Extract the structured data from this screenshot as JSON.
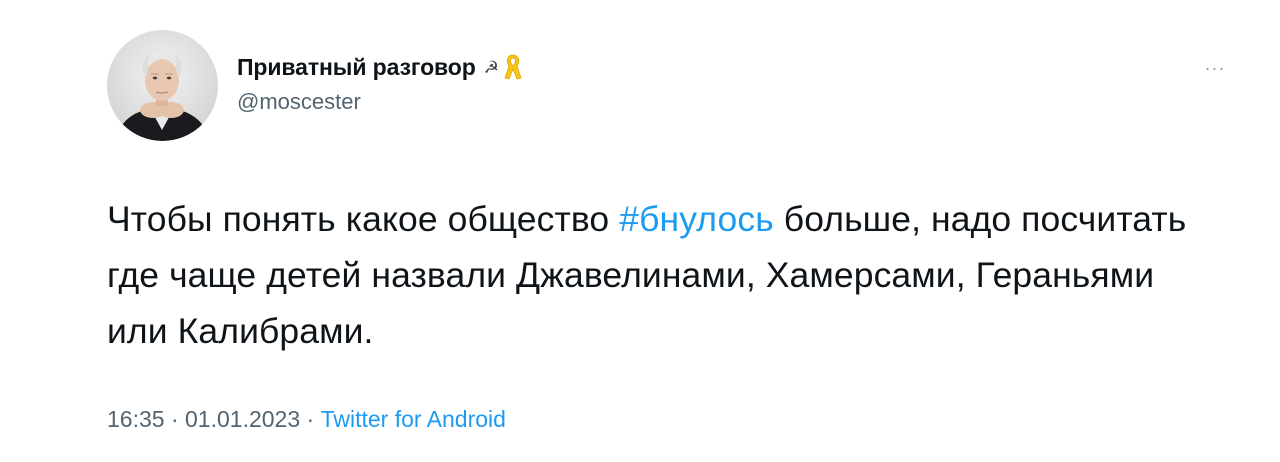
{
  "tweet": {
    "display_name": "Приватный разговор",
    "name_symbol": "☭",
    "handle": "@moscester",
    "more_label": "···",
    "text_before_hashtag": "Чтобы понять какое общество ",
    "hashtag": "#бнулось",
    "text_after_hashtag": " больше, надо посчитать где чаще детей назвали Джавелинами, Хамерсами, Гераньями или Калибрами.",
    "time": "16:35",
    "separator": " · ",
    "date": "01.01.2023",
    "source": "Twitter for Android"
  },
  "icons": {
    "avatar": "profile-photo",
    "ribbon": "yellow-ribbon-icon",
    "more": "more-options-icon"
  },
  "colors": {
    "link": "#1d9bf0",
    "text": "#0f1419",
    "secondary": "#536471",
    "ribbon": "#f5c518"
  }
}
